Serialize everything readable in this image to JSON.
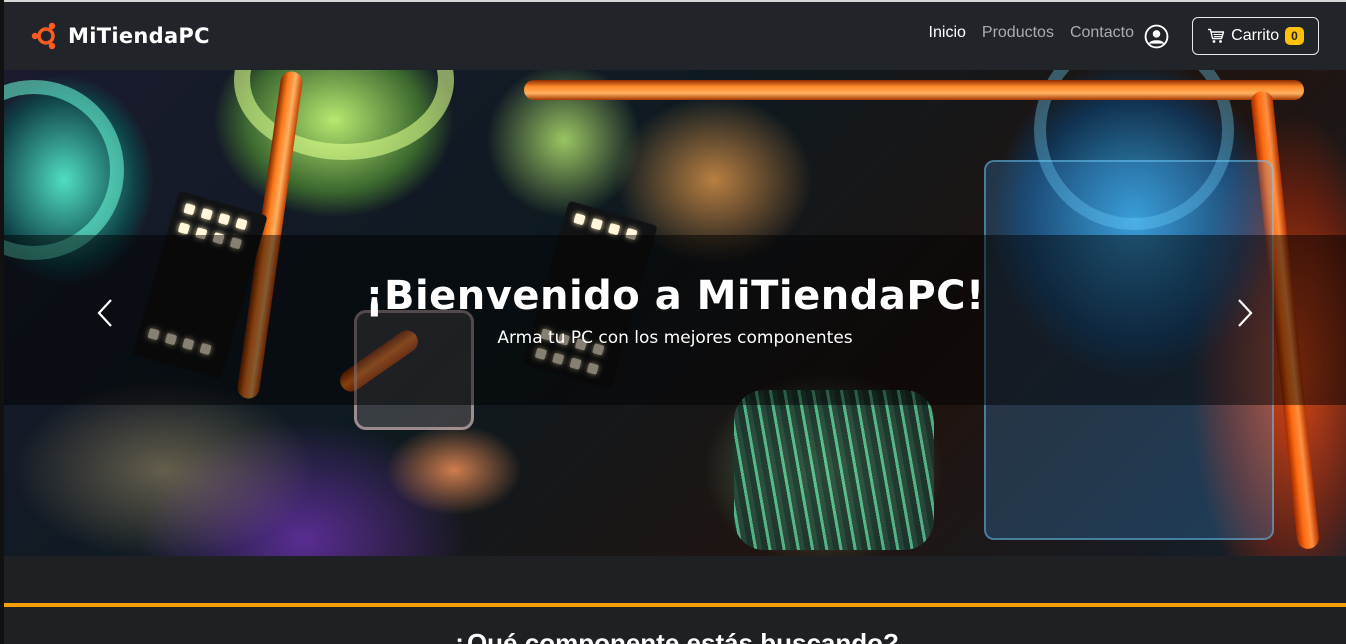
{
  "navbar": {
    "brand": "MiTiendaPC",
    "links": [
      {
        "label": "Inicio",
        "active": true
      },
      {
        "label": "Productos",
        "active": false
      },
      {
        "label": "Contacto",
        "active": false
      }
    ],
    "user_icon": "user-circle-icon",
    "cart": {
      "label": "Carrito",
      "count": "0",
      "icon": "shopping-cart-icon"
    }
  },
  "hero": {
    "title": "¡Bienvenido a MiTiendaPC!",
    "subtitle": "Arma tu PC con los mejores componentes",
    "prev_icon": "chevron-left-icon",
    "next_icon": "chevron-right-icon"
  },
  "section": {
    "title": "¿Qué componente estás buscando?"
  },
  "colors": {
    "navbar_bg": "#212529",
    "page_bg": "#1e2023",
    "brand_accent": "#ff5a1f",
    "badge": "#ffc107",
    "accent_line": "#f5a000"
  }
}
